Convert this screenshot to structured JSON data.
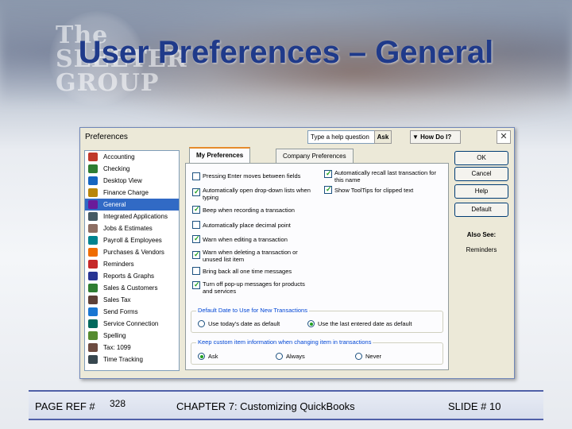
{
  "slide": {
    "title": "User Preferences – General",
    "logo_text": "The\nSLEETER\nGROUP"
  },
  "dialog": {
    "title": "Preferences",
    "help_placeholder": "Type a help question",
    "ask_label": "Ask",
    "howdo_label": "▼ How Do I?",
    "close_label": "✕"
  },
  "categories": [
    {
      "label": "Accounting",
      "icon_color": "#c0392b",
      "selected": false
    },
    {
      "label": "Checking",
      "icon_color": "#2e7d32",
      "selected": false
    },
    {
      "label": "Desktop View",
      "icon_color": "#1565c0",
      "selected": false
    },
    {
      "label": "Finance Charge",
      "icon_color": "#b8860b",
      "selected": false
    },
    {
      "label": "General",
      "icon_color": "#6a1b9a",
      "selected": true
    },
    {
      "label": "Integrated Applications",
      "icon_color": "#455a64",
      "selected": false
    },
    {
      "label": "Jobs & Estimates",
      "icon_color": "#8d6e63",
      "selected": false
    },
    {
      "label": "Payroll & Employees",
      "icon_color": "#00838f",
      "selected": false
    },
    {
      "label": "Purchases & Vendors",
      "icon_color": "#ef6c00",
      "selected": false
    },
    {
      "label": "Reminders",
      "icon_color": "#c62828",
      "selected": false
    },
    {
      "label": "Reports & Graphs",
      "icon_color": "#283593",
      "selected": false
    },
    {
      "label": "Sales & Customers",
      "icon_color": "#2e7d32",
      "selected": false
    },
    {
      "label": "Sales Tax",
      "icon_color": "#5d4037",
      "selected": false
    },
    {
      "label": "Send Forms",
      "icon_color": "#1976d2",
      "selected": false
    },
    {
      "label": "Service Connection",
      "icon_color": "#00695c",
      "selected": false
    },
    {
      "label": "Spelling",
      "icon_color": "#558b2f",
      "selected": false
    },
    {
      "label": "Tax: 1099",
      "icon_color": "#6d4c41",
      "selected": false
    },
    {
      "label": "Time Tracking",
      "icon_color": "#37474f",
      "selected": false
    }
  ],
  "tabs": [
    {
      "label": "My Preferences",
      "active": true
    },
    {
      "label": "Company Preferences",
      "active": false
    }
  ],
  "options_left": [
    {
      "label": "Pressing Enter moves between fields",
      "checked": false
    },
    {
      "label": "Automatically open drop-down lists when typing",
      "checked": true
    },
    {
      "label": "Beep when recording a transaction",
      "checked": true
    },
    {
      "label": "Automatically place decimal point",
      "checked": false
    },
    {
      "label": "Warn when editing a transaction",
      "checked": true
    },
    {
      "label": "Warn when deleting a transaction or unused list item",
      "checked": true
    },
    {
      "label": "Bring back all one time messages",
      "checked": false
    },
    {
      "label": "Turn off pop-up messages for products and services",
      "checked": true
    }
  ],
  "options_right": [
    {
      "label": "Automatically recall last transaction for this name",
      "checked": true
    },
    {
      "label": "Show ToolTips for clipped text",
      "checked": true
    }
  ],
  "group_date": {
    "label": "Default Date to Use for New Transactions",
    "options": [
      {
        "label": "Use today's date as default",
        "selected": false
      },
      {
        "label": "Use the last entered date as default",
        "selected": true
      }
    ]
  },
  "group_item": {
    "label": "Keep custom item information when changing item in transactions",
    "options": [
      {
        "label": "Ask",
        "selected": true
      },
      {
        "label": "Always",
        "selected": false
      },
      {
        "label": "Never",
        "selected": false
      }
    ]
  },
  "buttons": {
    "ok": "OK",
    "cancel": "Cancel",
    "help": "Help",
    "default": "Default",
    "also_see": "Also See:",
    "reminders": "Reminders"
  },
  "footer": {
    "page_ref_label": "PAGE REF #",
    "page_ref_number": "328",
    "chapter": "CHAPTER 7: Customizing QuickBooks",
    "slide_number": "SLIDE # 10"
  }
}
